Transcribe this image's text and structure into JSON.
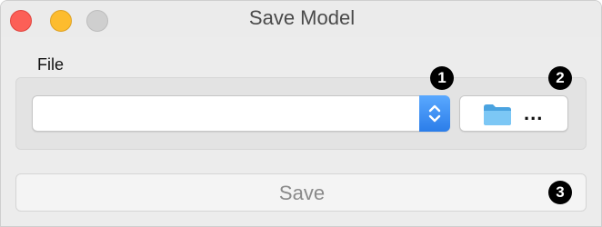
{
  "window": {
    "title": "Save Model"
  },
  "file_section": {
    "label": "File",
    "combo_value": "",
    "browse_label": "..."
  },
  "save_button": {
    "label": "Save"
  },
  "badges": [
    "1",
    "2",
    "3"
  ],
  "icons": {
    "combo_arrow": "up-down-chevron-icon",
    "browse": "folder-icon"
  },
  "colors": {
    "close": "#fc5f57",
    "minimize": "#fdbc2e",
    "maximize": "#cfcfcf",
    "accent": "#2b7de9",
    "folder": "#63b9f2"
  }
}
